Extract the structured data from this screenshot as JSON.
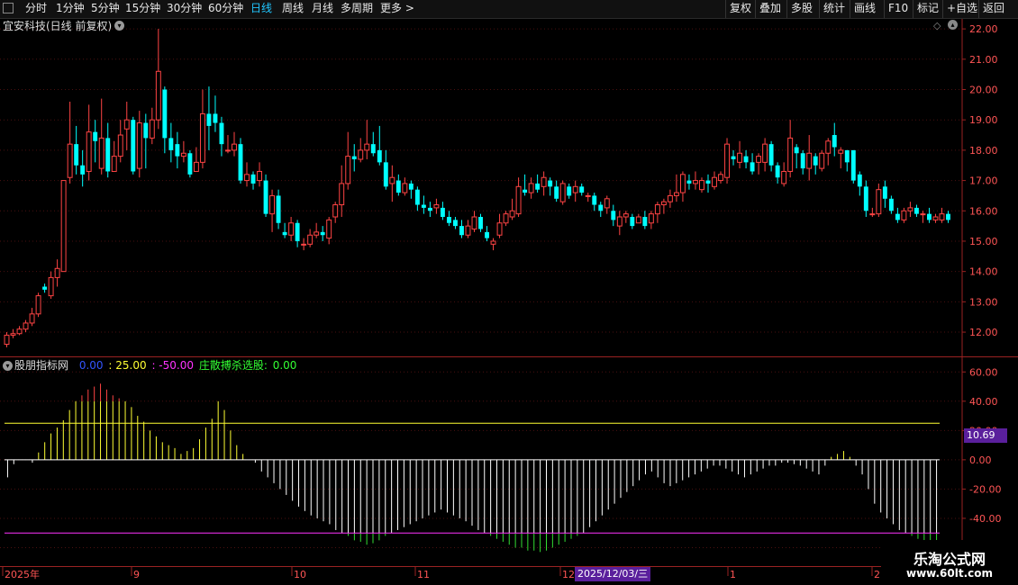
{
  "toolbar": {
    "periods": [
      "分时",
      "1分钟",
      "5分钟",
      "15分钟",
      "30分钟",
      "60分钟",
      "日线",
      "周线",
      "月线",
      "多周期",
      "更多 >"
    ],
    "active_period": "日线",
    "actions": [
      "复权",
      "叠加",
      "多股",
      "统计",
      "画线",
      "F10",
      "标记",
      "+自选",
      "返回"
    ]
  },
  "main_chart": {
    "title": "宜安科技(日线 前复权)",
    "y_ticks": [
      "22.00",
      "21.00",
      "20.00",
      "19.00",
      "18.00",
      "17.00",
      "16.00",
      "15.00",
      "14.00",
      "13.00",
      "12.00"
    ]
  },
  "indicator": {
    "name": "股朋指标网",
    "v1": "0.00",
    "v2": ": 25.00",
    "v3": ": -50.00",
    "v4_label": "庄散搏杀选股:",
    "v4": "0.00",
    "y_ticks": [
      "60.00",
      "40.00",
      "20.00",
      "0.00",
      "-20.00",
      "-40.00",
      "-60.00"
    ],
    "current_value": "10.69"
  },
  "x_axis": {
    "labels": [
      "2025年",
      "9",
      "10",
      "11",
      "12",
      "1",
      "2"
    ],
    "cursor_date": "2025/12/03/三"
  },
  "watermark": {
    "name": "乐淘公式网",
    "url": "www.60lt.com"
  },
  "colors": {
    "up": "#ff4444",
    "down": "#00ffff",
    "yellow": "#ffff33",
    "magenta": "#ff33ff",
    "axis": "#9a2222",
    "grid": "#4a1010",
    "badge": "#5a1f9c"
  },
  "chart_data": {
    "type": "candlestick",
    "main": {
      "ylim": [
        11.2,
        22.3
      ],
      "candles": [
        [
          11.6,
          11.9,
          11.5,
          12.0
        ],
        [
          11.9,
          11.95,
          11.8,
          12.1
        ],
        [
          11.95,
          12.1,
          11.9,
          12.2
        ],
        [
          12.1,
          12.3,
          12.0,
          12.4
        ],
        [
          12.3,
          12.6,
          12.2,
          12.8
        ],
        [
          12.6,
          13.2,
          12.5,
          13.3
        ],
        [
          13.5,
          13.4,
          13.3,
          13.6
        ],
        [
          13.2,
          13.8,
          13.1,
          14.0
        ],
        [
          13.8,
          14.1,
          13.5,
          14.4
        ],
        [
          14.0,
          17.0,
          14.0,
          17.0
        ],
        [
          17.1,
          18.2,
          16.9,
          19.6
        ],
        [
          18.2,
          17.5,
          17.2,
          18.8
        ],
        [
          17.5,
          17.2,
          16.8,
          18.0
        ],
        [
          17.3,
          18.6,
          17.0,
          19.5
        ],
        [
          18.6,
          18.3,
          17.6,
          19.0
        ],
        [
          17.4,
          18.4,
          17.2,
          19.7
        ],
        [
          18.4,
          17.3,
          17.1,
          18.9
        ],
        [
          17.3,
          17.8,
          17.3,
          18.3
        ],
        [
          17.8,
          18.5,
          17.6,
          19.0
        ],
        [
          18.7,
          19.0,
          18.0,
          19.6
        ],
        [
          19.0,
          17.3,
          17.2,
          19.1
        ],
        [
          17.4,
          18.9,
          17.1,
          19.3
        ],
        [
          18.9,
          18.4,
          17.4,
          19.2
        ],
        [
          18.4,
          19.0,
          18.2,
          19.4
        ],
        [
          19.0,
          20.6,
          18.7,
          22.0
        ],
        [
          20.0,
          18.4,
          17.9,
          20.1
        ],
        [
          18.4,
          18.0,
          17.6,
          18.9
        ],
        [
          18.2,
          17.8,
          17.4,
          18.6
        ],
        [
          17.8,
          17.9,
          17.6,
          18.3
        ],
        [
          17.9,
          17.2,
          17.1,
          18.0
        ],
        [
          17.3,
          17.6,
          17.3,
          18.1
        ],
        [
          17.6,
          19.2,
          17.4,
          20.0
        ],
        [
          19.2,
          18.8,
          18.0,
          20.1
        ],
        [
          19.2,
          18.9,
          18.6,
          19.8
        ],
        [
          18.9,
          18.2,
          17.8,
          19.1
        ],
        [
          18.0,
          18.0,
          17.9,
          18.5
        ],
        [
          18.0,
          18.2,
          17.8,
          18.6
        ],
        [
          18.2,
          17.0,
          16.9,
          18.4
        ],
        [
          17.0,
          17.2,
          16.8,
          17.6
        ],
        [
          17.2,
          16.9,
          16.7,
          17.3
        ],
        [
          17.0,
          17.3,
          16.8,
          17.6
        ],
        [
          17.0,
          15.9,
          15.8,
          17.2
        ],
        [
          15.9,
          16.5,
          15.3,
          16.7
        ],
        [
          16.5,
          15.6,
          15.4,
          16.7
        ],
        [
          15.3,
          15.2,
          15.1,
          15.6
        ],
        [
          15.2,
          15.6,
          15.0,
          15.8
        ],
        [
          15.6,
          15.0,
          14.8,
          15.7
        ],
        [
          14.9,
          14.9,
          14.7,
          15.1
        ],
        [
          14.9,
          15.2,
          14.8,
          15.4
        ],
        [
          15.2,
          15.3,
          15.1,
          15.6
        ],
        [
          15.3,
          15.2,
          15.0,
          15.5
        ],
        [
          15.1,
          15.7,
          14.9,
          15.8
        ],
        [
          15.8,
          16.2,
          15.6,
          16.3
        ],
        [
          16.2,
          16.9,
          15.8,
          17.5
        ],
        [
          16.9,
          17.8,
          16.7,
          18.6
        ],
        [
          17.8,
          17.7,
          17.3,
          18.2
        ],
        [
          17.7,
          18.0,
          17.6,
          18.4
        ],
        [
          18.0,
          18.2,
          17.7,
          19.0
        ],
        [
          18.2,
          17.9,
          17.8,
          18.6
        ],
        [
          18.0,
          17.6,
          17.5,
          18.8
        ],
        [
          17.6,
          16.8,
          16.7,
          18.0
        ],
        [
          16.9,
          17.1,
          16.3,
          17.5
        ],
        [
          17.0,
          16.6,
          16.5,
          17.2
        ],
        [
          16.6,
          16.9,
          16.5,
          17.1
        ],
        [
          16.9,
          16.7,
          16.4,
          17.0
        ],
        [
          16.7,
          16.2,
          16.0,
          16.8
        ],
        [
          16.2,
          16.1,
          15.9,
          16.5
        ],
        [
          16.1,
          16.0,
          15.8,
          16.3
        ],
        [
          16.1,
          16.2,
          15.9,
          16.4
        ],
        [
          16.1,
          15.8,
          15.7,
          16.3
        ],
        [
          15.8,
          15.6,
          15.5,
          16.0
        ],
        [
          15.7,
          15.5,
          15.4,
          15.8
        ],
        [
          15.5,
          15.2,
          15.1,
          15.7
        ],
        [
          15.2,
          15.5,
          15.1,
          15.7
        ],
        [
          15.4,
          15.8,
          15.3,
          16.0
        ],
        [
          15.8,
          15.4,
          15.3,
          15.9
        ],
        [
          15.3,
          15.1,
          15.0,
          15.5
        ],
        [
          14.9,
          15.0,
          14.7,
          15.1
        ],
        [
          15.2,
          15.6,
          15.1,
          15.9
        ],
        [
          15.6,
          15.9,
          15.5,
          16.0
        ],
        [
          15.8,
          16.0,
          15.7,
          16.4
        ],
        [
          15.9,
          16.8,
          15.8,
          17.1
        ],
        [
          16.7,
          16.6,
          16.5,
          17.2
        ],
        [
          16.6,
          16.9,
          16.4,
          17.1
        ],
        [
          16.9,
          16.7,
          16.6,
          17.2
        ],
        [
          16.8,
          17.1,
          16.5,
          17.3
        ],
        [
          17.0,
          16.8,
          16.5,
          17.1
        ],
        [
          16.8,
          16.4,
          16.3,
          17.0
        ],
        [
          16.3,
          16.9,
          16.2,
          17.0
        ],
        [
          16.8,
          16.5,
          16.4,
          16.9
        ],
        [
          16.6,
          16.8,
          16.3,
          17.0
        ],
        [
          16.8,
          16.6,
          16.5,
          16.9
        ],
        [
          16.5,
          16.5,
          16.3,
          16.6
        ],
        [
          16.5,
          16.2,
          16.0,
          16.6
        ],
        [
          16.2,
          16.0,
          15.8,
          16.3
        ],
        [
          16.1,
          16.4,
          15.9,
          16.5
        ],
        [
          16.0,
          15.7,
          15.5,
          16.2
        ],
        [
          15.5,
          15.8,
          15.2,
          16.0
        ],
        [
          15.8,
          15.9,
          15.6,
          16.0
        ],
        [
          15.8,
          15.5,
          15.4,
          15.9
        ],
        [
          15.6,
          15.8,
          15.6,
          15.9
        ],
        [
          15.8,
          15.5,
          15.4,
          16.0
        ],
        [
          15.6,
          15.9,
          15.4,
          16.0
        ],
        [
          15.9,
          16.2,
          15.6,
          16.3
        ],
        [
          16.2,
          16.3,
          15.9,
          16.4
        ],
        [
          16.3,
          16.5,
          16.1,
          16.7
        ],
        [
          16.5,
          16.6,
          16.3,
          17.2
        ],
        [
          16.6,
          17.2,
          16.3,
          17.3
        ],
        [
          17.0,
          16.9,
          16.7,
          17.2
        ],
        [
          16.9,
          17.0,
          16.7,
          17.3
        ],
        [
          16.7,
          17.0,
          16.6,
          17.1
        ],
        [
          17.0,
          16.9,
          16.6,
          17.2
        ],
        [
          16.8,
          17.1,
          16.7,
          17.3
        ],
        [
          17.0,
          17.2,
          16.9,
          17.3
        ],
        [
          17.1,
          18.2,
          16.9,
          18.4
        ],
        [
          17.8,
          17.7,
          17.5,
          18.0
        ],
        [
          17.6,
          17.9,
          17.4,
          18.3
        ],
        [
          17.8,
          17.6,
          17.4,
          18.0
        ],
        [
          17.6,
          17.3,
          17.2,
          17.9
        ],
        [
          17.6,
          17.8,
          17.2,
          17.9
        ],
        [
          17.6,
          18.2,
          17.3,
          18.4
        ],
        [
          18.2,
          17.5,
          17.3,
          18.3
        ],
        [
          17.5,
          17.1,
          16.9,
          17.6
        ],
        [
          16.9,
          17.3,
          16.8,
          17.6
        ],
        [
          17.3,
          18.4,
          17.1,
          19.0
        ],
        [
          18.1,
          17.9,
          17.4,
          18.2
        ],
        [
          17.9,
          17.4,
          17.2,
          18.0
        ],
        [
          17.4,
          17.9,
          17.0,
          18.5
        ],
        [
          17.8,
          17.5,
          17.2,
          17.9
        ],
        [
          17.4,
          17.9,
          17.3,
          18.0
        ],
        [
          17.9,
          18.3,
          17.5,
          18.4
        ],
        [
          18.5,
          18.1,
          17.8,
          18.9
        ],
        [
          17.9,
          18.0,
          17.4,
          18.1
        ],
        [
          18.0,
          17.6,
          17.3,
          18.0
        ],
        [
          18.0,
          17.0,
          16.9,
          18.0
        ],
        [
          17.2,
          16.8,
          16.5,
          17.3
        ],
        [
          16.8,
          16.0,
          15.8,
          17.0
        ],
        [
          15.9,
          15.9,
          15.8,
          16.1
        ],
        [
          15.9,
          16.7,
          15.8,
          16.9
        ],
        [
          16.8,
          16.4,
          16.1,
          17.0
        ],
        [
          16.4,
          16.0,
          15.9,
          16.5
        ],
        [
          15.9,
          15.7,
          15.6,
          16.1
        ],
        [
          15.7,
          16.0,
          15.6,
          16.1
        ],
        [
          16.0,
          16.1,
          15.8,
          16.3
        ],
        [
          16.1,
          15.9,
          15.8,
          16.2
        ],
        [
          15.9,
          15.9,
          15.6,
          16.0
        ],
        [
          15.9,
          15.7,
          15.6,
          16.1
        ],
        [
          15.7,
          15.8,
          15.6,
          15.9
        ],
        [
          15.7,
          15.9,
          15.6,
          16.1
        ],
        [
          15.9,
          15.7,
          15.6,
          16.0
        ]
      ]
    },
    "indicator": {
      "ylim": [
        -72,
        70
      ],
      "yellow_level": 25,
      "magenta_level": -50,
      "histogram": [
        -12,
        -3,
        0,
        0,
        -2,
        5,
        12,
        18,
        22,
        27,
        34,
        40,
        44,
        48,
        50,
        52,
        48,
        44,
        42,
        40,
        36,
        30,
        26,
        20,
        16,
        12,
        10,
        8,
        4,
        6,
        8,
        14,
        22,
        28,
        40,
        34,
        20,
        10,
        4,
        0,
        -2,
        -8,
        -12,
        -16,
        -20,
        -24,
        -28,
        -32,
        -35,
        -38,
        -40,
        -42,
        -44,
        -48,
        -50,
        -52,
        -55,
        -56,
        -58,
        -57,
        -55,
        -52,
        -50,
        -48,
        -46,
        -44,
        -42,
        -40,
        -38,
        -36,
        -34,
        -36,
        -38,
        -40,
        -42,
        -45,
        -48,
        -50,
        -52,
        -54,
        -56,
        -58,
        -60,
        -60,
        -62,
        -62,
        -63,
        -62,
        -60,
        -58,
        -56,
        -54,
        -52,
        -50,
        -46,
        -42,
        -38,
        -34,
        -30,
        -26,
        -22,
        -18,
        -14,
        -10,
        -8,
        -12,
        -16,
        -18,
        -16,
        -14,
        -12,
        -10,
        -8,
        -6,
        -4,
        -4,
        -6,
        -8,
        -10,
        -12,
        -10,
        -8,
        -6,
        -4,
        -4,
        -2,
        -2,
        -3,
        -4,
        -6,
        -8,
        -10,
        -4,
        2,
        4,
        6,
        2,
        -4,
        -10,
        -20,
        -30,
        -36,
        -40,
        -44,
        -48,
        -50,
        -52,
        -54,
        -56,
        -58,
        -60
      ]
    }
  }
}
